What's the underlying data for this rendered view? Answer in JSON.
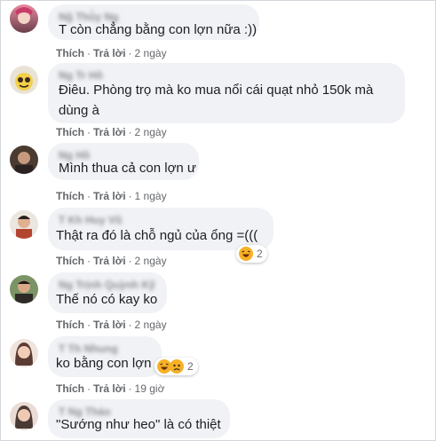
{
  "comments": [
    {
      "author": "Ng̃ Thù̉y Ng",
      "text": "T còn chẳng bằng con lợn nữa :))",
      "like": "Thích",
      "reply": "Trả lời",
      "time": "2 ngày",
      "avatar_colors": [
        "#e88aa0",
        "#6a3f4a"
      ]
    },
    {
      "author": "Ng Tr Hồ",
      "text": "Điêu. Phòng trọ mà ko mua nổi cái quạt nhỏ 150k mà dùng à",
      "like": "Thích",
      "reply": "Trả lời",
      "time": "2 ngày",
      "avatar_colors": [
        "#f2d14b",
        "#7a5a2a"
      ]
    },
    {
      "author": "Ng Hồ",
      "text": "Mình thua cả con lợn ư",
      "like": "Thích",
      "reply": "Trả lời",
      "time": "1 ngày",
      "avatar_colors": [
        "#5a4a3c",
        "#2a2220"
      ]
    },
    {
      "author": "T Kh Huy Vũ",
      "text": "Thật ra đó là chỗ ngủ của ổng =(((",
      "like": "Thích",
      "reply": "Trả lời",
      "time": "2 ngày",
      "avatar_colors": [
        "#b3452e",
        "#3a2a24"
      ],
      "reactions": {
        "icons": [
          "haha-icon"
        ],
        "count": "2"
      }
    },
    {
      "author": "Ng Trịnh Quỳnh Kỹ",
      "text": "Thế nó có kay ko",
      "like": "Thích",
      "reply": "Trả lời",
      "time": "2 ngày",
      "avatar_colors": [
        "#6f8c5a",
        "#2d2a28"
      ]
    },
    {
      "author": "T Th Nhung",
      "text": "ko bằng con lợn",
      "like": "Thích",
      "reply": "Trả lời",
      "time": "19 giờ",
      "avatar_colors": [
        "#e3c2b5",
        "#5a3c34"
      ],
      "reactions": {
        "icons": [
          "haha-icon",
          "sad-icon"
        ],
        "count": "2"
      }
    },
    {
      "author": "T Ng Thảo",
      "text": "\"Sướng như heo\" là có thiệt",
      "avatar_colors": [
        "#d9b7a8",
        "#4a3a36"
      ]
    }
  ]
}
